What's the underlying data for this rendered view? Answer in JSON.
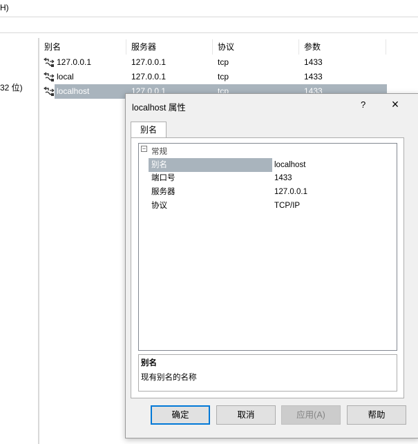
{
  "menubar": {
    "fragment": "H)"
  },
  "tree": {
    "fragment": "32 位)"
  },
  "list": {
    "columns": [
      "别名",
      "服务器",
      "协议",
      "参数"
    ],
    "rows": [
      {
        "alias": "127.0.0.1",
        "server": "127.0.0.1",
        "protocol": "tcp",
        "params": "1433",
        "selected": false
      },
      {
        "alias": "local",
        "server": "127.0.0.1",
        "protocol": "tcp",
        "params": "1433",
        "selected": false
      },
      {
        "alias": "localhost",
        "server": "127.0.0.1",
        "protocol": "tcp",
        "params": "1433",
        "selected": true
      }
    ]
  },
  "dialog": {
    "title": "localhost 属性",
    "help": "?",
    "close": "×",
    "tab": "别名",
    "category": "常规",
    "collapse_glyph": "−",
    "properties": [
      {
        "name": "别名",
        "value": "localhost"
      },
      {
        "name": "端口号",
        "value": "1433"
      },
      {
        "name": "服务器",
        "value": "127.0.0.1"
      },
      {
        "name": "协议",
        "value": "TCP/IP"
      }
    ],
    "description": {
      "title": "别名",
      "text": "现有别名的名称"
    },
    "buttons": {
      "ok": "确定",
      "cancel": "取消",
      "apply": "应用(A)",
      "help": "帮助"
    }
  },
  "colors": {
    "selection": "#a9b4bd",
    "dialog_bg": "#f0f0f0",
    "focus_border": "#0078d7"
  },
  "icons": {
    "row_icon": "network-alias-icon"
  }
}
